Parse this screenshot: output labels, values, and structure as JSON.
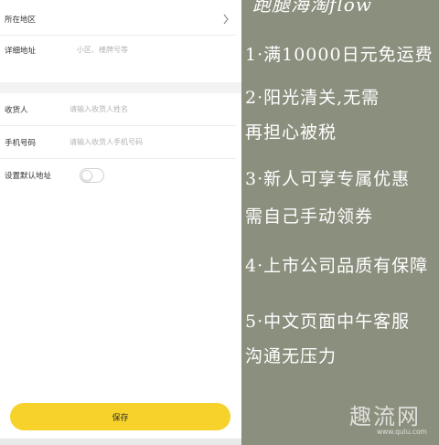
{
  "form": {
    "region_label": "所在地区",
    "address_label": "详细地址",
    "address_placeholder": "小区、楼牌号等",
    "receiver_label": "收货人",
    "receiver_placeholder": "请输入收货人姓名",
    "phone_label": "手机号码",
    "phone_placeholder": "请输入收货人手机号码",
    "default_label": "设置默认地址",
    "default_enabled": false,
    "save_label": "保存"
  },
  "note": {
    "title": "跑腿海淘flow",
    "lines": [
      "1·满10000日元免运费",
      "2·阳光清关,无需",
      "再担心被税",
      "3·新人可享专属优惠",
      "需自己手动领券",
      "4·上市公司品质有保障",
      "5·中文页面中午客服",
      "沟通无压力"
    ]
  },
  "watermark": {
    "logo": "趣流网",
    "url": "www.qulu.com"
  },
  "colors": {
    "accent": "#f6d22a",
    "note_bg": "#8b8f7e"
  }
}
